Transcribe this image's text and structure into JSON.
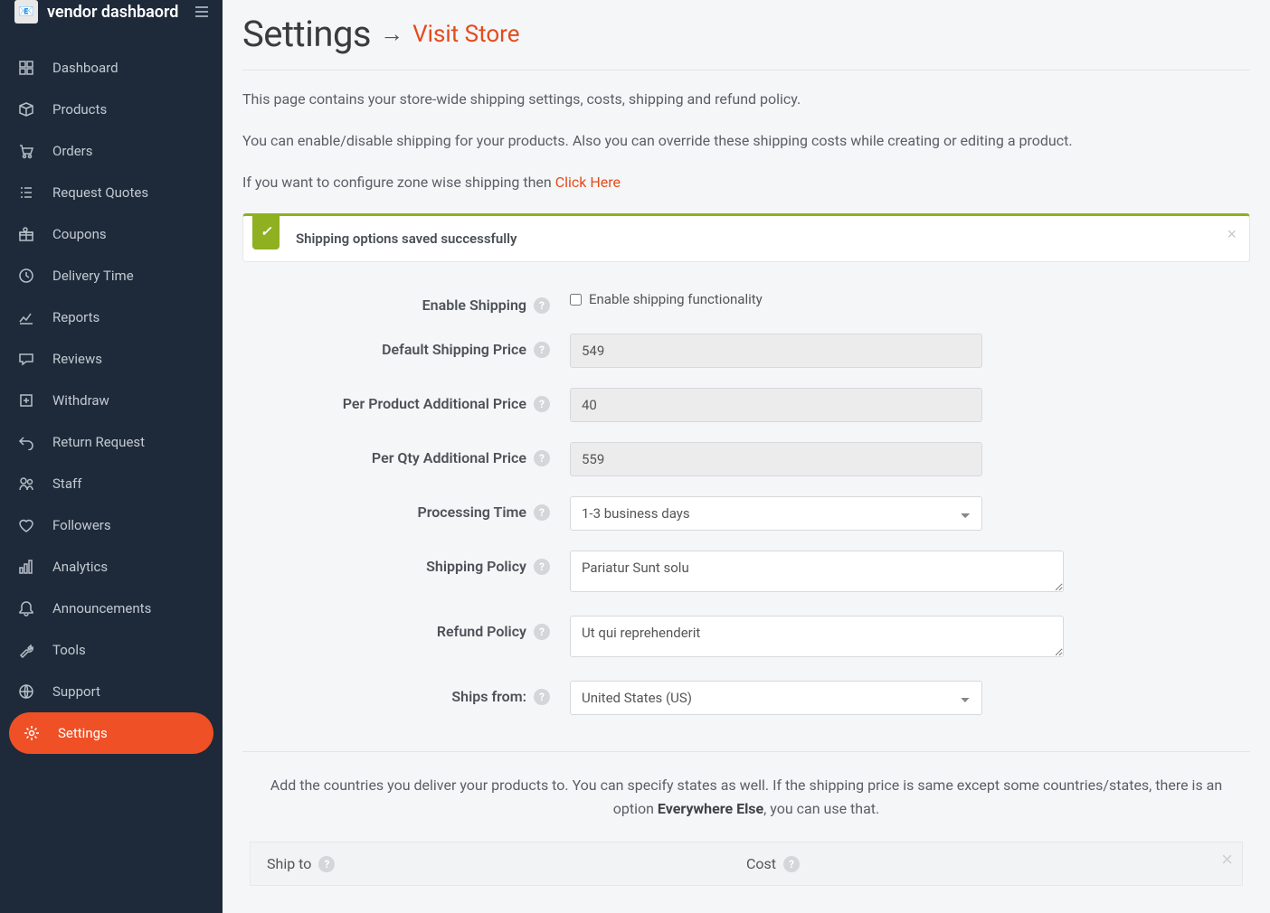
{
  "brand": {
    "title": "vendor dashbaord"
  },
  "sidebar": {
    "items": [
      {
        "label": "Dashboard",
        "icon": "dashboard"
      },
      {
        "label": "Products",
        "icon": "box"
      },
      {
        "label": "Orders",
        "icon": "cart"
      },
      {
        "label": "Request Quotes",
        "icon": "list"
      },
      {
        "label": "Coupons",
        "icon": "gift"
      },
      {
        "label": "Delivery Time",
        "icon": "clock"
      },
      {
        "label": "Reports",
        "icon": "chart"
      },
      {
        "label": "Reviews",
        "icon": "chat"
      },
      {
        "label": "Withdraw",
        "icon": "withdraw"
      },
      {
        "label": "Return Request",
        "icon": "undo"
      },
      {
        "label": "Staff",
        "icon": "users"
      },
      {
        "label": "Followers",
        "icon": "heart"
      },
      {
        "label": "Analytics",
        "icon": "bar"
      },
      {
        "label": "Announcements",
        "icon": "bell"
      },
      {
        "label": "Tools",
        "icon": "wrench"
      },
      {
        "label": "Support",
        "icon": "globe"
      },
      {
        "label": "Settings",
        "icon": "gear",
        "active": true
      }
    ]
  },
  "header": {
    "title": "Settings",
    "visit_store": "Visit Store"
  },
  "intro": {
    "p1": "This page contains your store-wide shipping settings, costs, shipping and refund policy.",
    "p2": "You can enable/disable shipping for your products. Also you can override these shipping costs while creating or editing a product.",
    "p3_prefix": "If you want to configure zone wise shipping then ",
    "p3_link": "Click Here"
  },
  "alert": {
    "message": "Shipping options saved successfully"
  },
  "form": {
    "enable_shipping_label": "Enable Shipping",
    "enable_shipping_checkbox_label": "Enable shipping functionality",
    "default_shipping_price_label": "Default Shipping Price",
    "default_shipping_price_value": "549",
    "per_product_additional_label": "Per Product Additional Price",
    "per_product_additional_value": "40",
    "per_qty_additional_label": "Per Qty Additional Price",
    "per_qty_additional_value": "559",
    "processing_time_label": "Processing Time",
    "processing_time_value": "1-3 business days",
    "shipping_policy_label": "Shipping Policy",
    "shipping_policy_value": "Pariatur Sunt solu",
    "refund_policy_label": "Refund Policy",
    "refund_policy_value": "Ut qui reprehenderit",
    "ships_from_label": "Ships from:",
    "ships_from_value": "United States (US)"
  },
  "countries_note": {
    "prefix": "Add the countries you deliver your products to. You can specify states as well. If the shipping price is same except some countries/states, there is an option ",
    "bold": "Everywhere Else",
    "suffix": ", you can use that."
  },
  "table": {
    "shipto": "Ship to",
    "cost": "Cost"
  }
}
